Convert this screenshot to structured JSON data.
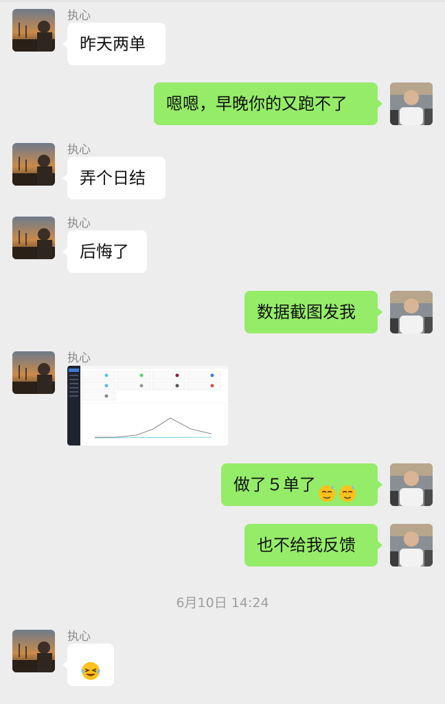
{
  "chat": {
    "contact_name": "执心",
    "timestamp": "6月10日 14:24",
    "messages": [
      {
        "side": "left",
        "text": "昨天两单"
      },
      {
        "side": "right",
        "text": "嗯嗯，早晚你的又跑不了"
      },
      {
        "side": "left",
        "text": "弄个日结"
      },
      {
        "side": "left",
        "text": "后悔了"
      },
      {
        "side": "right",
        "text": "数据截图发我"
      },
      {
        "side": "left",
        "type": "image",
        "image": "dashboard-screenshot"
      },
      {
        "side": "right",
        "text": "做了５单了",
        "emoji": [
          "sweat-smile-emoji",
          "sweat-smile-emoji"
        ]
      },
      {
        "side": "right",
        "text": "也不给我反馈"
      },
      {
        "side": "left",
        "type": "emoji",
        "emoji": "laughing-crying-emoji"
      }
    ]
  },
  "colors": {
    "background": "#ededed",
    "bubble_left": "#ffffff",
    "bubble_right": "#95ec69"
  }
}
